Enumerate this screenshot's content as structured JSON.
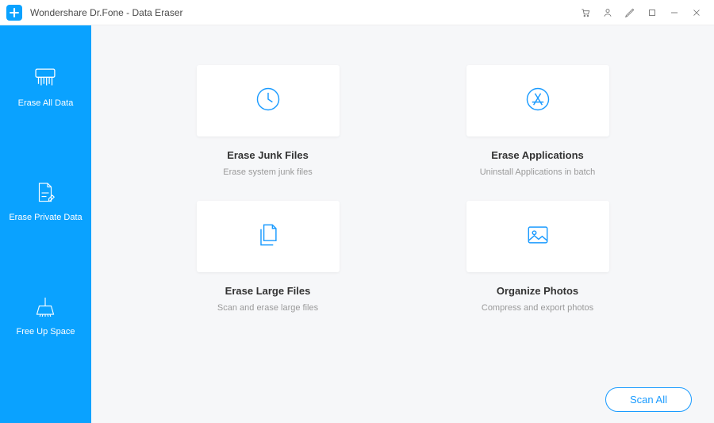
{
  "titlebar": {
    "title": "Wondershare Dr.Fone - Data Eraser"
  },
  "sidebar": {
    "items": [
      {
        "label": "Erase All Data"
      },
      {
        "label": "Erase Private Data"
      },
      {
        "label": "Free Up Space"
      }
    ]
  },
  "cards": [
    {
      "title": "Erase Junk Files",
      "sub": "Erase system junk files"
    },
    {
      "title": "Erase Applications",
      "sub": "Uninstall Applications in batch"
    },
    {
      "title": "Erase Large Files",
      "sub": "Scan and erase large files"
    },
    {
      "title": "Organize Photos",
      "sub": "Compress and export photos"
    }
  ],
  "actions": {
    "scan_all": "Scan All"
  }
}
